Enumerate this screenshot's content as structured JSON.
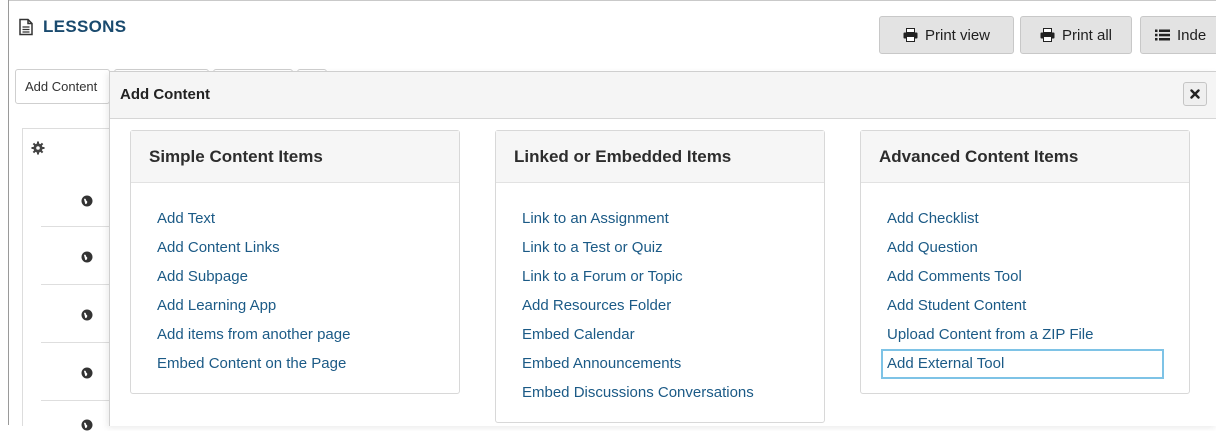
{
  "page": {
    "title": "LESSONS"
  },
  "toolbar": {
    "print_view": "Print view",
    "print_all": "Print all",
    "index": "Inde"
  },
  "background": {
    "tabs": [
      "Add Content",
      "",
      "",
      ""
    ]
  },
  "dialog": {
    "title": "Add Content",
    "close_icon": "close-icon",
    "columns": [
      {
        "heading": "Simple Content Items",
        "items": [
          "Add Text",
          "Add Content Links",
          "Add Subpage",
          "Add Learning App",
          "Add items from another page",
          "Embed Content on the Page"
        ]
      },
      {
        "heading": "Linked or Embedded Items",
        "items": [
          "Link to an Assignment",
          "Link to a Test or Quiz",
          "Link to a Forum or Topic",
          "Add Resources Folder",
          "Embed Calendar",
          "Embed Announcements",
          "Embed Discussions Conversations"
        ]
      },
      {
        "heading": "Advanced Content Items",
        "items": [
          "Add Checklist",
          "Add Question",
          "Add Comments Tool",
          "Add Student Content",
          "Upload Content from a ZIP File",
          "Add External Tool"
        ],
        "focused_item": "Add External Tool"
      }
    ]
  },
  "colors": {
    "title": "#1a4a6e",
    "link": "#1b5a86",
    "focus_ring": "#7ec3e6"
  }
}
